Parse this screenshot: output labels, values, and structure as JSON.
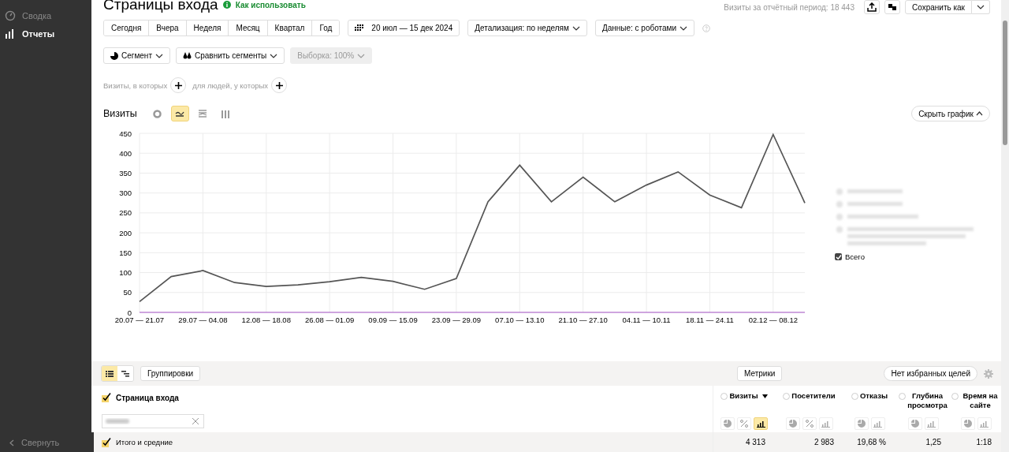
{
  "sidebar": {
    "items": [
      {
        "label": "Сводка",
        "selected": false
      },
      {
        "label": "Отчеты",
        "selected": true
      }
    ],
    "collapse": "Свернуть"
  },
  "header": {
    "title": "Страницы входа",
    "help_link": "Как использовать",
    "period_total": "Визиты за отчётный период: 18 443",
    "save": "Сохранить как"
  },
  "periods": [
    {
      "label": "Сегодня",
      "selected": false
    },
    {
      "label": "Вчера",
      "selected": false
    },
    {
      "label": "Неделя",
      "selected": false
    },
    {
      "label": "Месяц",
      "selected": false
    },
    {
      "label": "Квартал",
      "selected": false
    },
    {
      "label": "Год",
      "selected": false
    }
  ],
  "date_range": "20 июл — 15 дек 2024",
  "detail": "Детализация: по неделям",
  "data_filter": "Данные: с роботами",
  "segment": "Сегмент",
  "compare": "Сравнить сегменты",
  "sample": {
    "label": "Выборка: 100%",
    "disabled": true
  },
  "conditions": [
    "Визиты, в которых",
    "для людей, у которых"
  ],
  "chart": {
    "title": "Визиты",
    "types": [
      {
        "kind": "pie",
        "selected": false
      },
      {
        "kind": "line",
        "selected": true
      },
      {
        "kind": "area",
        "selected": false
      },
      {
        "kind": "bar",
        "selected": false
      }
    ],
    "hide": "Скрыть график",
    "legend_total": {
      "checked": true
    },
    "chart_data": {
      "type": "line",
      "categories": [
        "20.07 — 21.07",
        null,
        "29.07 — 04.08",
        null,
        "12.08 — 18.08",
        null,
        "26.08 — 01.09",
        null,
        "09.09 — 15.09",
        null,
        "23.09 — 29.09",
        null,
        "07.10 — 13.10",
        null,
        "21.10 — 27.10",
        null,
        "04.11 — 10.11",
        null,
        "18.11 — 24.11",
        null,
        "02.12 — 08.12",
        null
      ],
      "grid": true,
      "ylim": [
        0,
        450
      ],
      "yticks": [
        0,
        50,
        100,
        150,
        200,
        250,
        300,
        350,
        400,
        450
      ],
      "series": [
        {
          "name": "Всего",
          "color": "#555555",
          "values": [
            27,
            90,
            105,
            75,
            65,
            69,
            77,
            88,
            78,
            58,
            85,
            278,
            370,
            278,
            340,
            278,
            320,
            353,
            295,
            263,
            447,
            275
          ]
        }
      ]
    }
  },
  "table": {
    "view_modes": [
      {
        "kind": "list",
        "selected": true
      },
      {
        "kind": "tree",
        "selected": false
      }
    ],
    "groupings": "Группировки",
    "metrics": "Метрики",
    "goals": "Нет избранных целей",
    "dimension": {
      "label": "Страница входа",
      "checked": true
    },
    "columns": [
      {
        "label": "Визиты",
        "sorted": true,
        "modes": [
          {
            "kind": "pie",
            "selected": false
          },
          {
            "kind": "percent",
            "selected": false
          },
          {
            "kind": "bar",
            "selected": true
          }
        ]
      },
      {
        "label": "Посетители",
        "sorted": false,
        "modes": [
          {
            "kind": "pie",
            "selected": false
          },
          {
            "kind": "percent",
            "selected": false
          },
          {
            "kind": "bar",
            "selected": false
          }
        ]
      },
      {
        "label": "Отказы",
        "sorted": false,
        "modes": [
          {
            "kind": "pie",
            "selected": false
          },
          {
            "kind": "bar",
            "selected": false
          }
        ]
      },
      {
        "label": "Глубина просмотра",
        "sorted": false,
        "modes": [
          {
            "kind": "pie",
            "selected": false
          },
          {
            "kind": "bar",
            "selected": false
          }
        ]
      },
      {
        "label": "Время на сайте",
        "sorted": false,
        "modes": [
          {
            "kind": "pie",
            "selected": false
          },
          {
            "kind": "bar",
            "selected": false
          }
        ]
      }
    ],
    "totals": {
      "label": "Итого и средние",
      "checked": true,
      "values": [
        "4 313",
        "2 983",
        "19,68 %",
        "1,25",
        "1:18"
      ]
    }
  }
}
